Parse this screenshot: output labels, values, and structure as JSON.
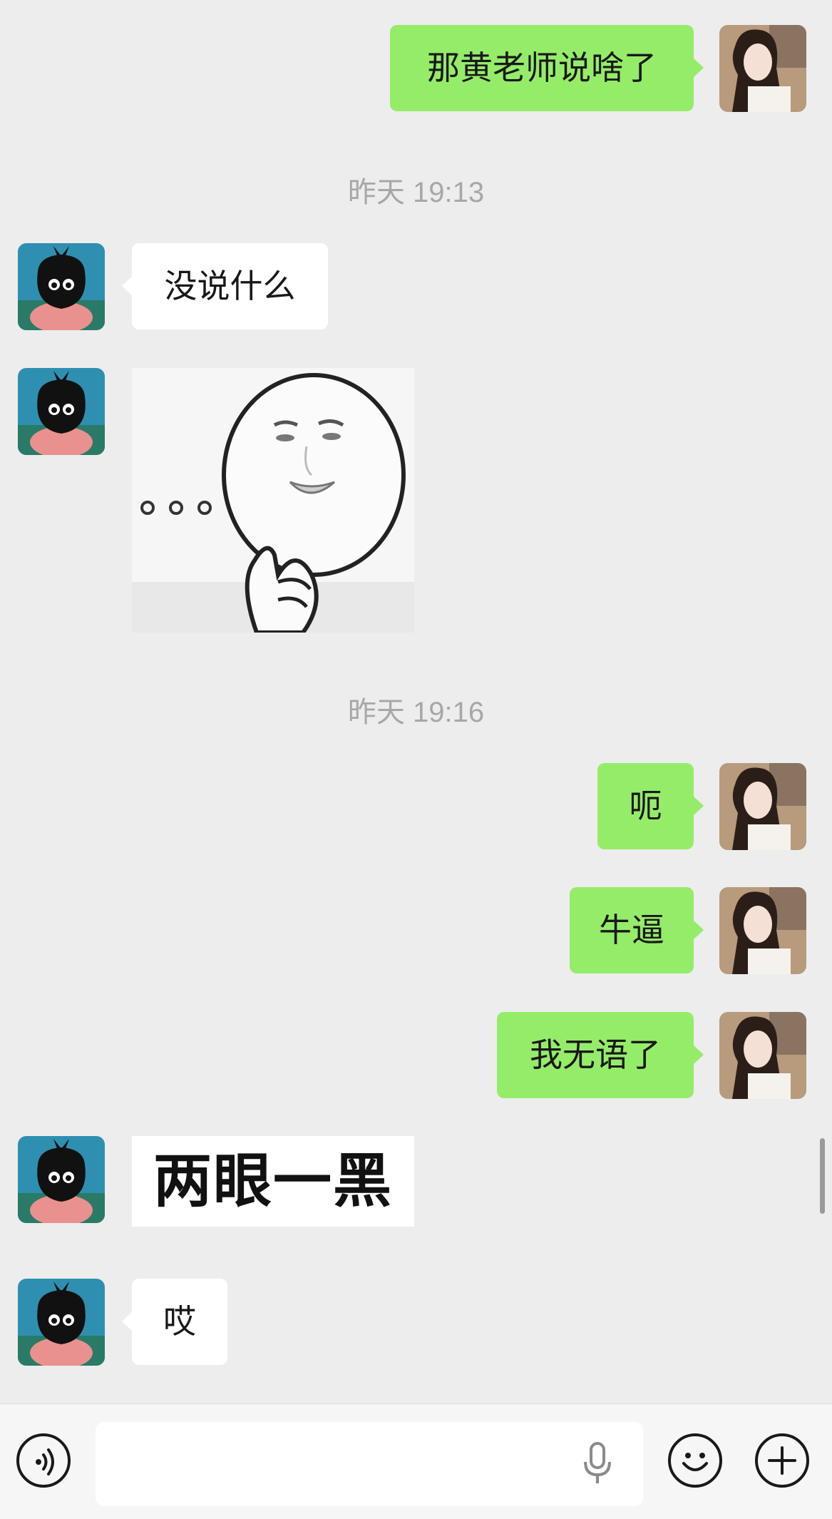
{
  "messages": {
    "m1": "那黄老师说啥了",
    "ts1": "昨天 19:13",
    "m2": "没说什么",
    "ts2": "昨天 19:16",
    "m3": "呃",
    "m4": "牛逼",
    "m5": "我无语了",
    "sticker_text": "两眼一黑",
    "m6": "哎"
  },
  "input": {
    "placeholder": ""
  },
  "icons": {
    "voice": "voice-icon",
    "mic": "microphone-icon",
    "emoji": "emoji-icon",
    "plus": "plus-icon"
  },
  "colors": {
    "background": "#ededed",
    "outgoing_bubble": "#95ec69",
    "incoming_bubble": "#ffffff",
    "timestamp": "#a7a7a7"
  }
}
